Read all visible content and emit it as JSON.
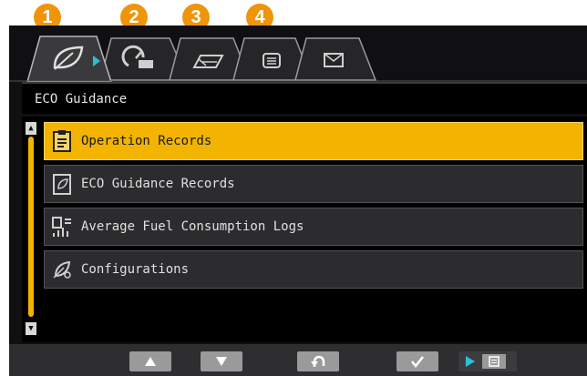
{
  "badges": [
    "1",
    "2",
    "3",
    "4"
  ],
  "tabs": [
    {
      "name": "eco-leaf-icon"
    },
    {
      "name": "fuel-gauge-icon"
    },
    {
      "name": "road-map-icon"
    },
    {
      "name": "list-menu-icon"
    },
    {
      "name": "mail-envelope-icon"
    }
  ],
  "header": {
    "title": "ECO Guidance"
  },
  "menu": {
    "items": [
      {
        "label": "Operation Records",
        "icon": "clipboard-icon",
        "selected": true
      },
      {
        "label": "ECO Guidance Records",
        "icon": "record-sheet-icon",
        "selected": false
      },
      {
        "label": "Average Fuel Consumption Logs",
        "icon": "fuel-log-icon",
        "selected": false
      },
      {
        "label": "Configurations",
        "icon": "settings-leaf-icon",
        "selected": false
      }
    ]
  },
  "colors": {
    "badge": "#f0940a",
    "selection": "#f2b400",
    "screen_bg": "#101012",
    "item_bg": "#2c2c2e",
    "accent_cyan": "#2bc0d6"
  },
  "bottom_buttons": [
    {
      "name": "up-arrow-icon"
    },
    {
      "name": "down-arrow-icon"
    },
    {
      "name": "return-icon"
    },
    {
      "name": "checkmark-icon"
    },
    {
      "name": "next-page-icon"
    }
  ]
}
